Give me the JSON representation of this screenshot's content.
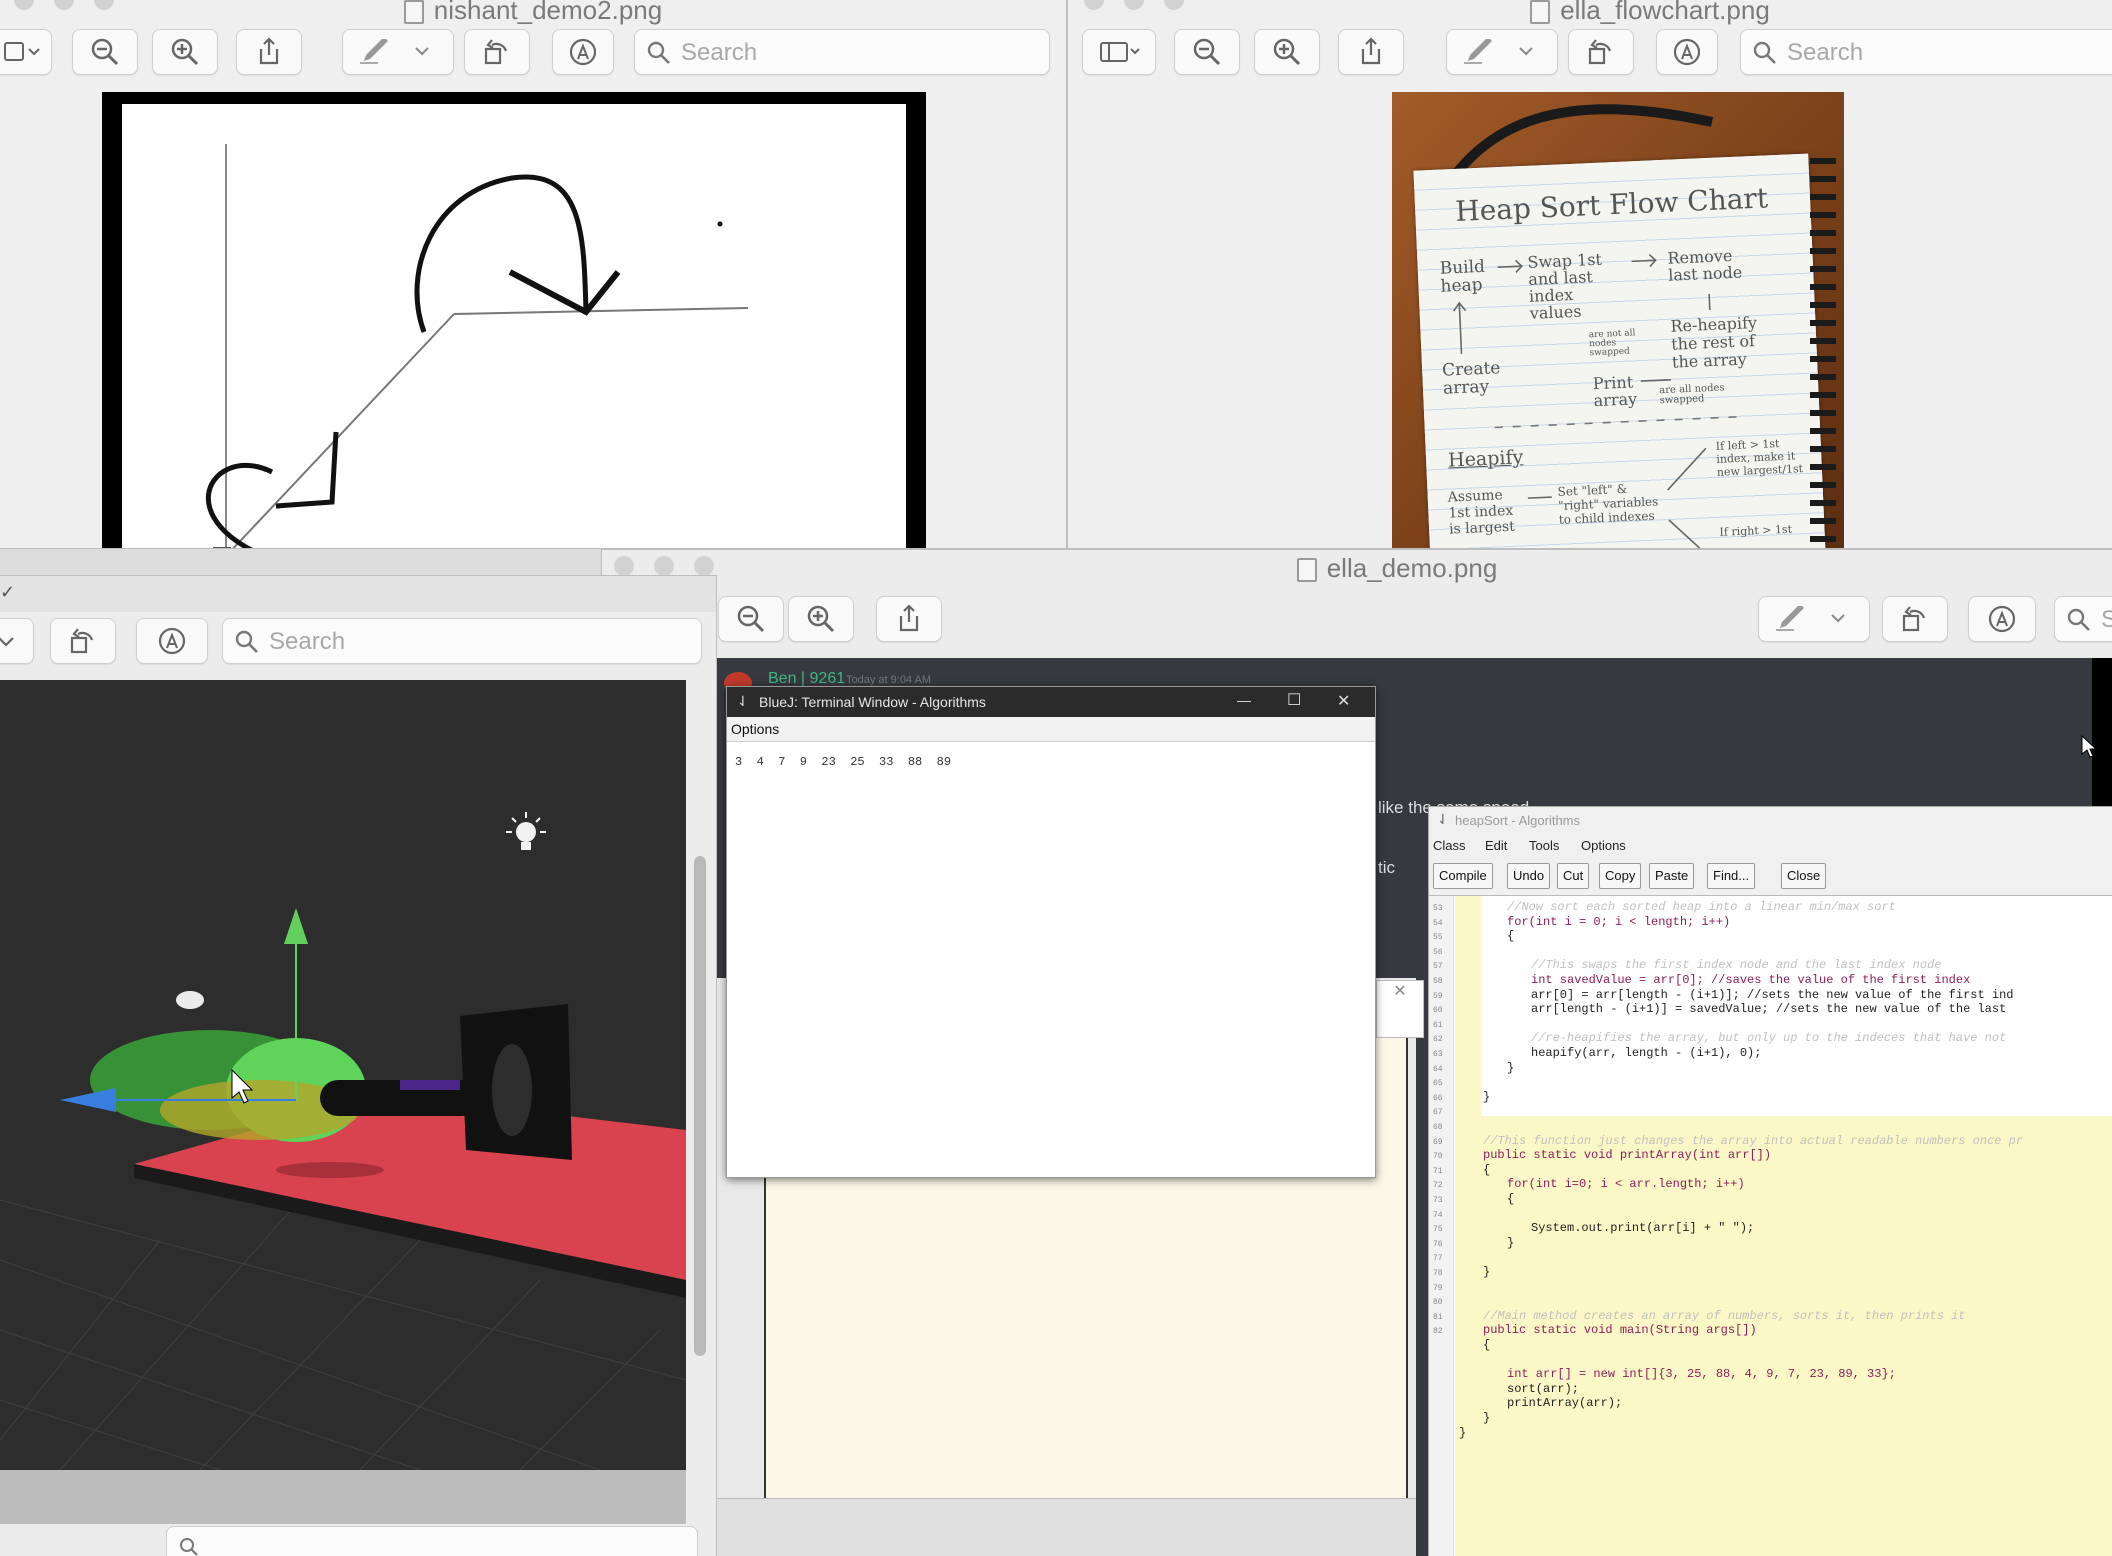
{
  "windows": {
    "nishant": {
      "title": "nishant_demo2.png",
      "search_placeholder": "Search"
    },
    "flowchart": {
      "title": "ella_flowchart.png",
      "search_placeholder": "Search"
    },
    "scene3d": {
      "search_placeholder": "Search",
      "bottom_search_placeholder": ""
    },
    "ella_demo": {
      "title": "ella_demo.png",
      "search_placeholder": "S"
    }
  },
  "flowchart_notes": {
    "title": "Heap Sort Flow Chart",
    "build": "Build heap",
    "swap": "Swap 1st and last index values",
    "remove": "Remove last node",
    "reheap": "Re-heapify the rest of the array",
    "create": "Create array",
    "print": "Print array",
    "heapify": "Heapify",
    "assume": "Assume 1st index is largest",
    "setlr": "Set \"left\" & \"right\" variables to child indexes",
    "if_left": "If left > 1st index, make it new largest/1st",
    "if_right": "If right > 1st",
    "not_swapped": "are not all nodes swapped",
    "all_swapped": "are all nodes swapped"
  },
  "chat": {
    "user": "Ben | 9261",
    "time": "Today at 9:04 AM",
    "message_fragment": "like the same speed",
    "tic": "tic"
  },
  "terminal": {
    "title": "BlueJ: Terminal Window - Algorithms",
    "menu_options": "Options",
    "output": "3  4  7  9  23  25  33  88  89",
    "minimize": "—",
    "maximize": "☐",
    "close": "✕"
  },
  "editor": {
    "title": "heapSort - Algorithms",
    "menu": [
      "Class",
      "Edit",
      "Tools",
      "Options"
    ],
    "buttons": [
      "Compile",
      "Undo",
      "Cut",
      "Copy",
      "Paste",
      "Find...",
      "Close"
    ],
    "line_numbers": [
      "53",
      "54",
      "55",
      "56",
      "57",
      "58",
      "59",
      "60",
      "61",
      "62",
      "63",
      "64",
      "65",
      "66",
      "67",
      "68",
      "69",
      "70",
      "71",
      "72",
      "73",
      "74",
      "75",
      "76",
      "77",
      "78",
      "79",
      "80",
      "81",
      "82"
    ],
    "lines": [
      "//Now sort each sorted heap into a linear min/max sort",
      "for(int i = 0; i < length; i++)",
      "{",
      "//This swaps the first index node and the last index node",
      "int savedValue = arr[0]; //saves the value of the first index",
      "arr[0] = arr[length - (i+1)]; //sets the new value of the first ind",
      "arr[length - (i+1)] = savedValue; //sets the new value of the last",
      "//re-heapifies the array, but only up to the indeces that have not",
      "heapify(arr, length - (i+1), 0);",
      "}",
      "}",
      "//This function just changes the array into actual readable numbers once pr",
      "public static void printArray(int arr[])",
      "{",
      "for(int i=0; i < arr.length; i++)",
      "{",
      "System.out.print(arr[i] + \" \");",
      "}",
      "}",
      "//Main method creates an array of numbers, sorts it, then prints it",
      "public static void main(String args[])",
      "{",
      "int arr[] = new int[]{3, 25, 88, 4, 9, 7, 23, 89, 33};",
      "sort(arr);",
      "printArray(arr);",
      "}",
      "}"
    ]
  },
  "colors": {
    "editor_highlight": "#fbf7c6",
    "platform_red": "#d9434f",
    "gizmo_green": "#63d05e",
    "gizmo_blue": "#3a7de0"
  }
}
